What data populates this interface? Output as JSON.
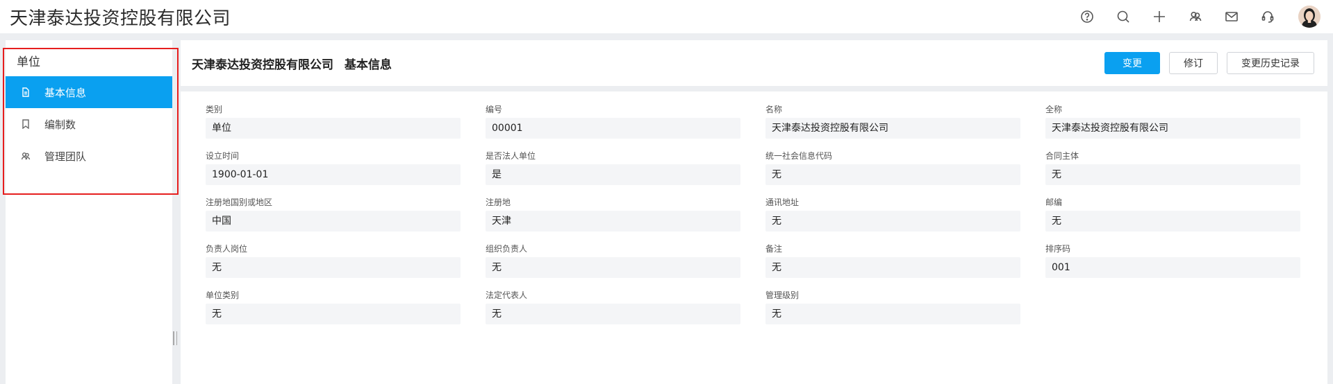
{
  "app": {
    "title": "天津泰达投资控股有限公司"
  },
  "topbar": {
    "icons": [
      "help-icon",
      "search-icon",
      "plus-icon",
      "team-icon",
      "mail-icon",
      "headset-icon"
    ]
  },
  "sidebar": {
    "header": "单位",
    "items": [
      {
        "label": "基本信息",
        "icon": "document-icon",
        "active": true
      },
      {
        "label": "编制数",
        "icon": "bookmark-icon",
        "active": false
      },
      {
        "label": "管理团队",
        "icon": "team-icon",
        "active": false
      }
    ]
  },
  "main": {
    "title": "天津泰达投资控股有限公司",
    "subtitle": "基本信息",
    "actions": {
      "change": "变更",
      "revise": "修订",
      "history": "变更历史记录"
    }
  },
  "form": {
    "fields": [
      {
        "label": "类别",
        "value": "单位"
      },
      {
        "label": "编号",
        "value": "00001"
      },
      {
        "label": "名称",
        "value": "天津泰达投资控股有限公司"
      },
      {
        "label": "全称",
        "value": "天津泰达投资控股有限公司"
      },
      {
        "label": "设立时间",
        "value": "1900-01-01"
      },
      {
        "label": "是否法人单位",
        "value": "是"
      },
      {
        "label": "统一社会信息代码",
        "value": "无"
      },
      {
        "label": "合同主体",
        "value": "无"
      },
      {
        "label": "注册地国别或地区",
        "value": "中国"
      },
      {
        "label": "注册地",
        "value": "天津"
      },
      {
        "label": "通讯地址",
        "value": "无"
      },
      {
        "label": "邮编",
        "value": "无"
      },
      {
        "label": "负责人岗位",
        "value": "无"
      },
      {
        "label": "组织负责人",
        "value": "无"
      },
      {
        "label": "备注",
        "value": "无"
      },
      {
        "label": "排序码",
        "value": "001"
      },
      {
        "label": "单位类别",
        "value": "无"
      },
      {
        "label": "法定代表人",
        "value": "无"
      },
      {
        "label": "管理级别",
        "value": "无"
      }
    ]
  },
  "colors": {
    "accent": "#0aa0f0",
    "highlight_border": "#e61e1e",
    "field_bg": "#f4f5f7"
  }
}
